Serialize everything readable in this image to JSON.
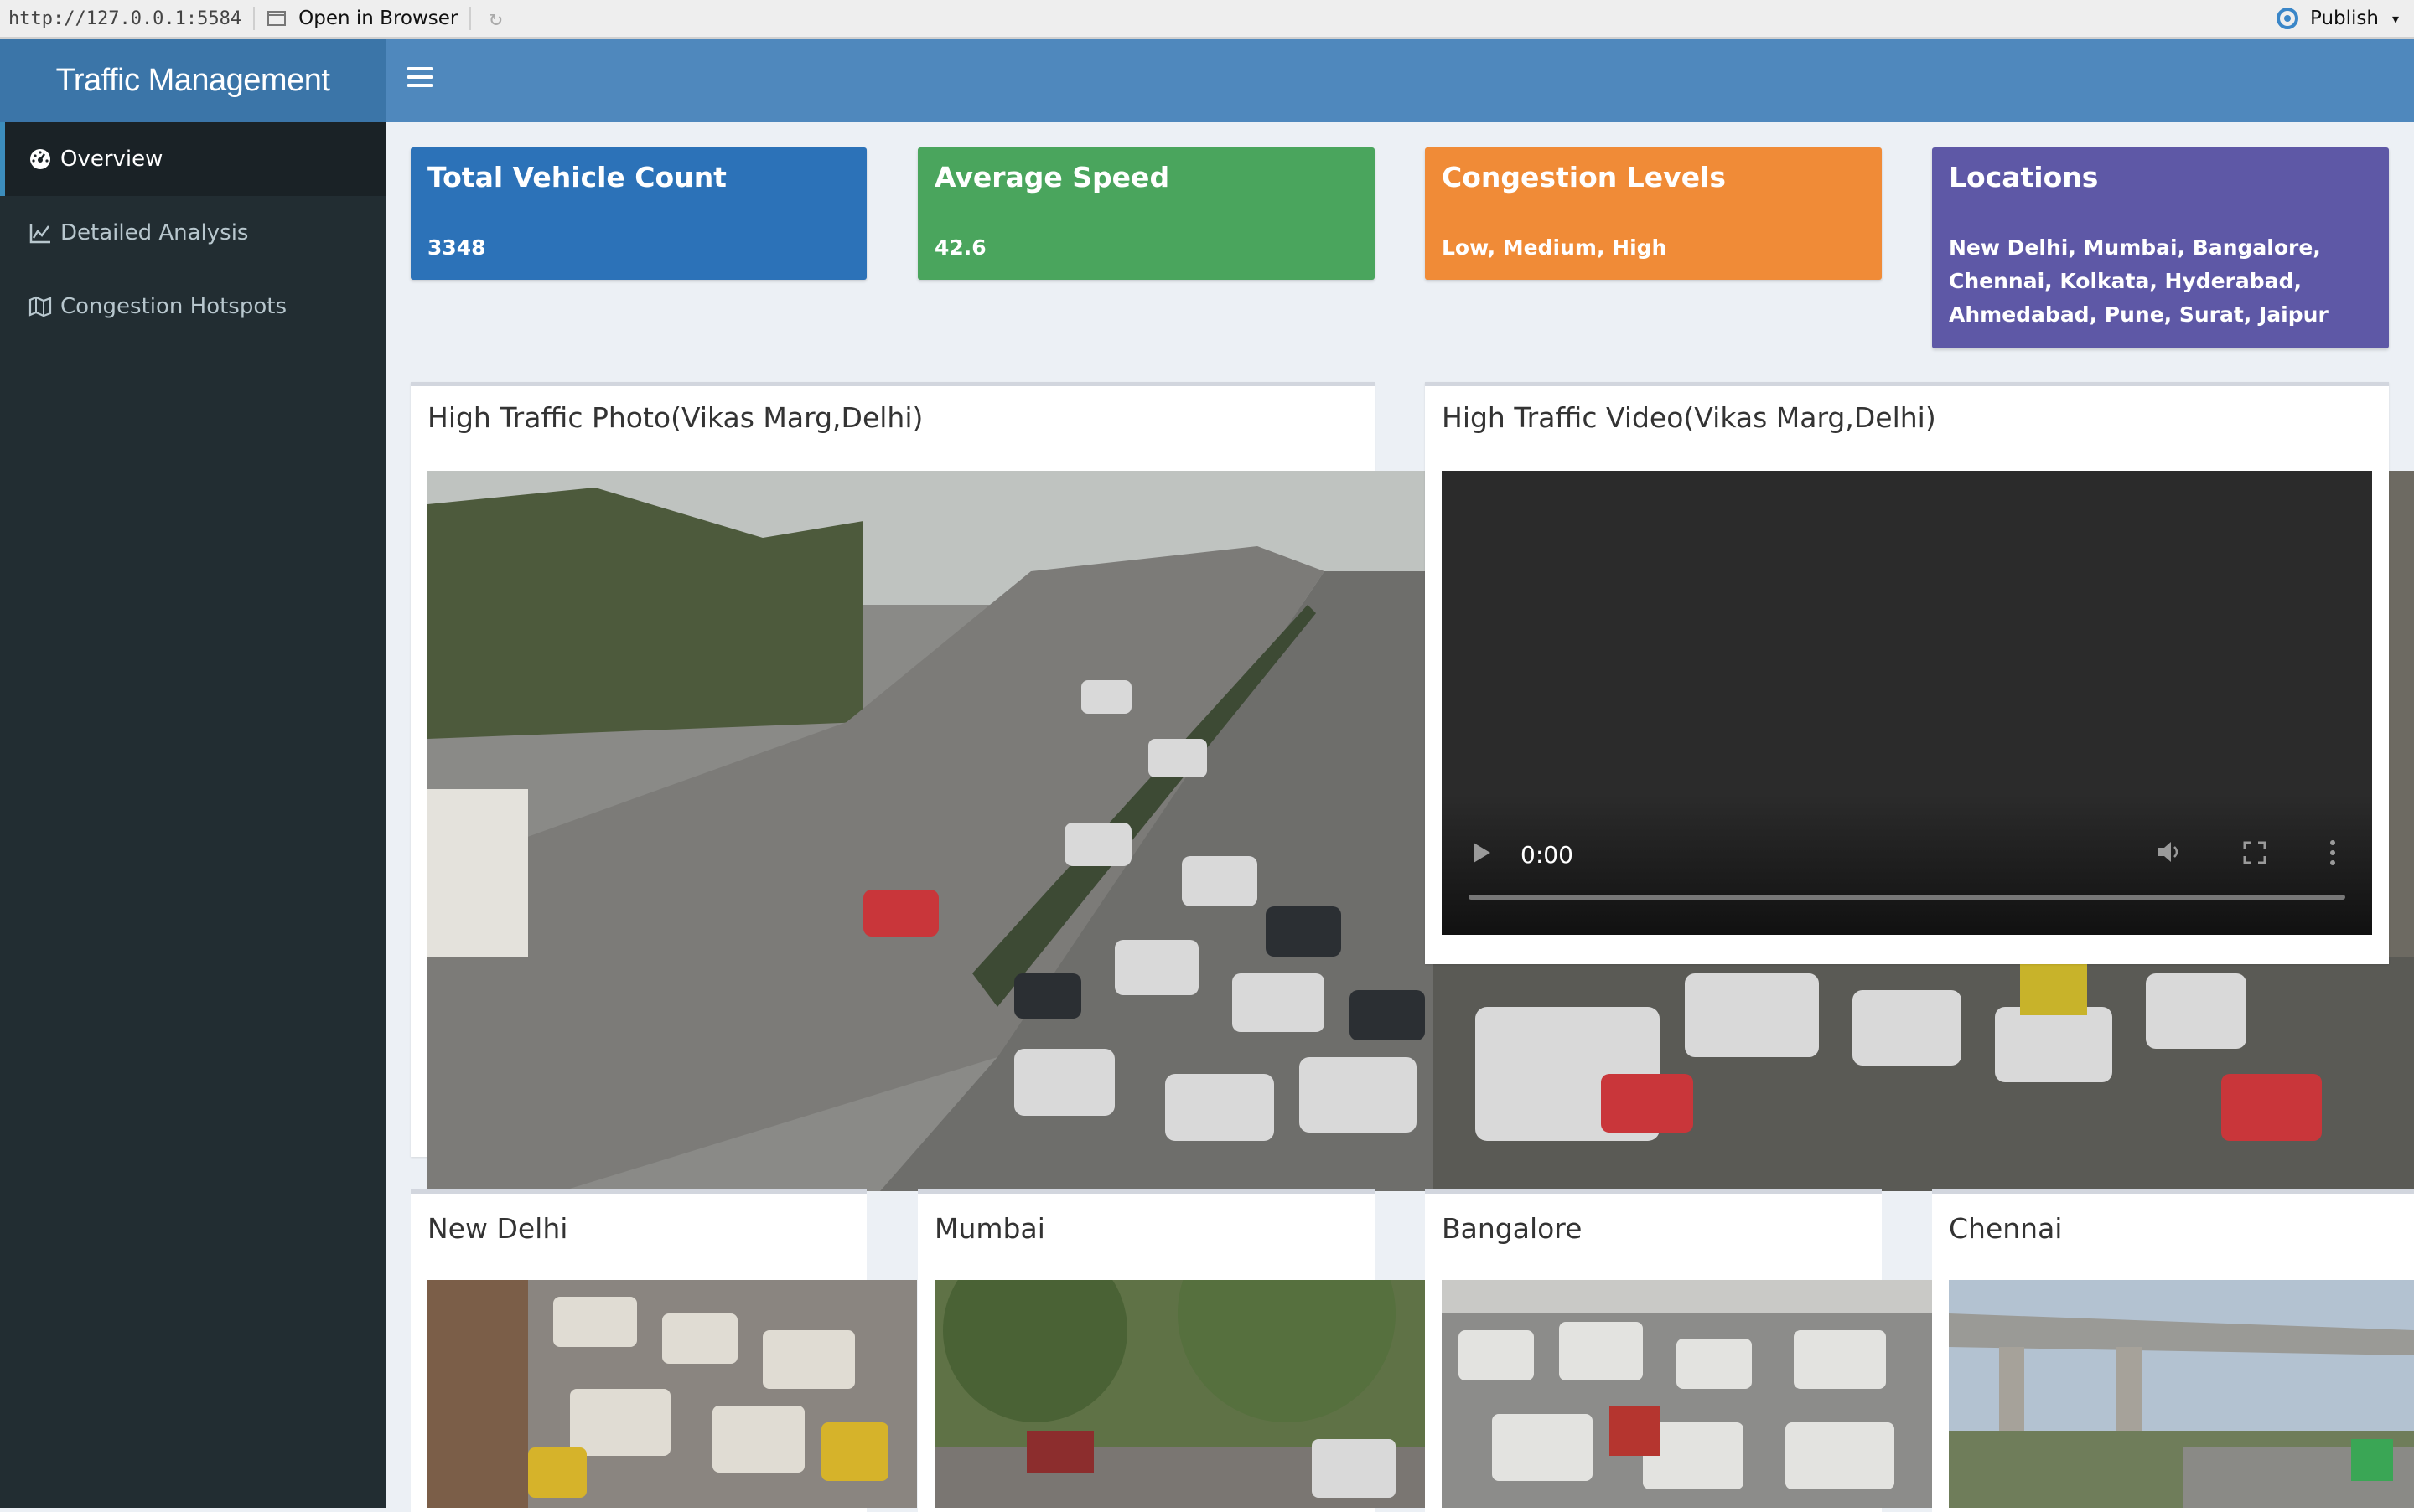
{
  "browser": {
    "url": "http://127.0.0.1:5584",
    "open_in_browser": "Open in Browser",
    "publish": "Publish"
  },
  "app": {
    "title": "Traffic Management"
  },
  "sidebar": {
    "items": [
      {
        "label": "Overview",
        "icon": "dashboard-icon",
        "active": true
      },
      {
        "label": "Detailed Analysis",
        "icon": "line-chart-icon",
        "active": false
      },
      {
        "label": "Congestion Hotspots",
        "icon": "map-icon",
        "active": false
      }
    ]
  },
  "value_boxes": [
    {
      "title": "Total Vehicle Count",
      "value": "3348",
      "color": "#2c72b8"
    },
    {
      "title": "Average Speed",
      "value": "42.6",
      "color": "#4aa55d"
    },
    {
      "title": "Congestion Levels",
      "value": "Low, Medium, High",
      "color": "#f08b37"
    },
    {
      "title": "Locations",
      "value": "New Delhi, Mumbai, Bangalore, Chennai, Kolkata, Hyderabad, Ahmedabad, Pune, Surat, Jaipur",
      "color": "#5e58a6"
    }
  ],
  "panels": {
    "photo_title": "High Traffic Photo(Vikas Marg,Delhi)",
    "video_title": "High Traffic Video(Vikas Marg,Delhi)",
    "video_time": "0:00"
  },
  "cities": [
    {
      "title": "New Delhi"
    },
    {
      "title": "Mumbai"
    },
    {
      "title": "Bangalore"
    },
    {
      "title": "Chennai"
    }
  ]
}
